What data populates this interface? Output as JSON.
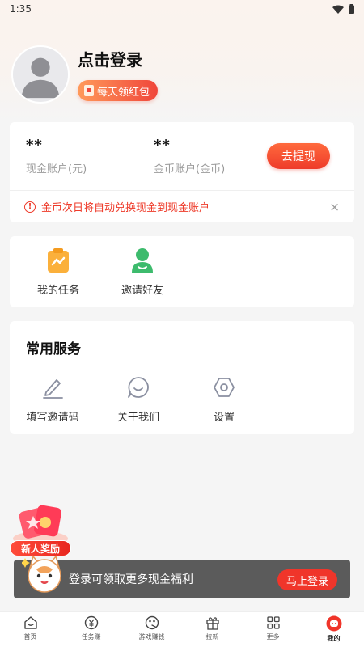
{
  "status_bar": {
    "time": "1:35"
  },
  "profile": {
    "login_prompt": "点击登录",
    "redpack_label": "每天领红包"
  },
  "wallet": {
    "cash_value": "**",
    "cash_label": "现金账户(元)",
    "coin_value": "**",
    "coin_label": "金币账户(金币)",
    "withdraw_label": "去提现",
    "notice_text": "金币次日将自动兑换现金到现金账户",
    "notice_close": "×"
  },
  "tasks": [
    {
      "label": "我的任务",
      "icon": "task-clipboard-icon"
    },
    {
      "label": "邀请好友",
      "icon": "invite-friend-icon"
    }
  ],
  "services": {
    "title": "常用服务",
    "items": [
      {
        "label": "填写邀请码",
        "icon": "pencil-icon"
      },
      {
        "label": "关于我们",
        "icon": "chat-smile-icon"
      },
      {
        "label": "设置",
        "icon": "hexagon-settings-icon"
      }
    ]
  },
  "newbie": {
    "label": "新人奖励"
  },
  "login_banner": {
    "text": "登录可领取更多现金福利",
    "button": "马上登录"
  },
  "tabbar": [
    {
      "label": "首页",
      "icon": "home-icon",
      "active": false
    },
    {
      "label": "任务赚",
      "icon": "yuan-coin-icon",
      "active": false
    },
    {
      "label": "游戏赚钱",
      "icon": "game-controller-icon",
      "active": false
    },
    {
      "label": "拉新",
      "icon": "gift-icon",
      "active": false
    },
    {
      "label": "更多",
      "icon": "grid-icon",
      "active": false
    },
    {
      "label": "我的",
      "icon": "profile-face-icon",
      "active": true
    }
  ],
  "colors": {
    "accent": "#ee3b2a",
    "background": "#f5f5f5",
    "card": "#ffffff"
  }
}
